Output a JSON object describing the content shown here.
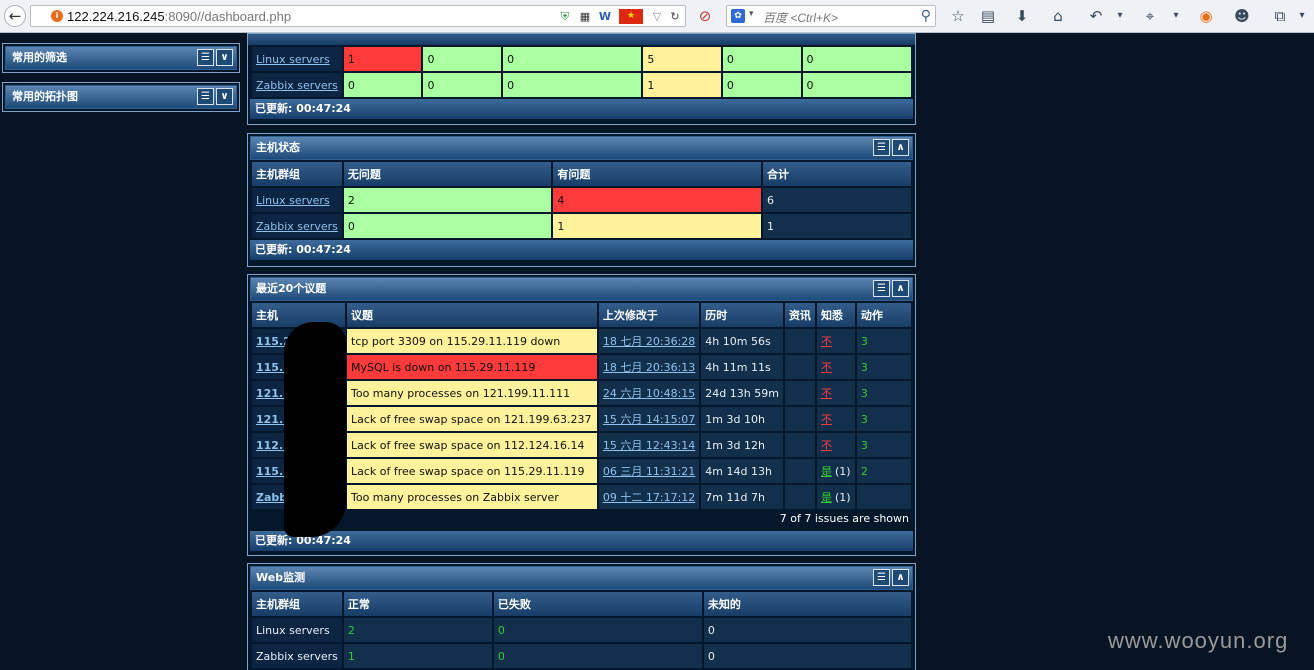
{
  "browser": {
    "url_host": "122.224.216.245",
    "url_rest": ":8090//dashboard.php",
    "search_engine_label": "百度",
    "search_placeholder": "<Ctrl+K>",
    "icons": [
      "back-icon",
      "site-icon",
      "shield-icon",
      "qr-icon",
      "word-icon",
      "china-flag-icon",
      "dropdown-icon",
      "reload-icon",
      "block-icon",
      "paw-icon",
      "search-icon",
      "star-icon",
      "clipboard-icon",
      "download-icon",
      "home-icon",
      "undo-icon",
      "crop-icon",
      "firefox-icon",
      "user-icon",
      "window-icon"
    ]
  },
  "left_panels": [
    {
      "title": "常用的筛选"
    },
    {
      "title": "常用的拓扑图"
    }
  ],
  "trigger_overview": {
    "rows": [
      {
        "group": "Linux servers",
        "cells": [
          "1",
          "0",
          "0",
          "5",
          "0",
          "0"
        ],
        "colors": [
          "r",
          "g",
          "g",
          "y",
          "g",
          "g"
        ]
      },
      {
        "group": "Zabbix servers",
        "cells": [
          "0",
          "0",
          "0",
          "1",
          "0",
          "0"
        ],
        "colors": [
          "g",
          "g",
          "g",
          "y",
          "g",
          "g"
        ]
      }
    ],
    "footer": "已更新: 00:47:24"
  },
  "host_status": {
    "title": "主机状态",
    "headers": [
      "主机群组",
      "无问题",
      "有问题",
      "合计"
    ],
    "rows": [
      {
        "group": "Linux servers",
        "ok": "2",
        "problem": "4",
        "total": "6",
        "problem_color": "r"
      },
      {
        "group": "Zabbix servers",
        "ok": "0",
        "problem": "1",
        "total": "1",
        "problem_color": "y"
      }
    ],
    "footer": "已更新: 00:47:24"
  },
  "last_issues": {
    "title": "最近20个议题",
    "headers": [
      "主机",
      "议题",
      "上次修改于",
      "历时",
      "资讯",
      "知悉",
      "动作"
    ],
    "rows": [
      {
        "host": "115.2",
        "issue": "tcp port 3309 on 115.29.11.119 down",
        "issue_color": "y",
        "changed": "18 七月 20:36:28",
        "age": "4h 10m 56s",
        "ack": "不",
        "ack_type": "no",
        "actions": "3"
      },
      {
        "host": "115.2",
        "issue": "MySQL is down on 115.29.11.119",
        "issue_color": "r",
        "changed": "18 七月 20:36:13",
        "age": "4h 11m 11s",
        "ack": "不",
        "ack_type": "no",
        "actions": "3"
      },
      {
        "host": "121.1",
        "issue": "Too many processes on 121.199.11.111",
        "issue_color": "y",
        "changed": "24 六月 10:48:15",
        "age": "24d 13h 59m",
        "ack": "不",
        "ack_type": "no",
        "actions": "3"
      },
      {
        "host": "121.1",
        "issue": "Lack of free swap space on 121.199.63.237",
        "issue_color": "y",
        "changed": "15 六月 14:15:07",
        "age": "1m 3d 10h",
        "ack": "不",
        "ack_type": "no",
        "actions": "3"
      },
      {
        "host": "112.1",
        "issue": "Lack of free swap space on 112.124.16.14",
        "issue_color": "y",
        "changed": "15 六月 12:43:14",
        "age": "1m 3d 12h",
        "ack": "不",
        "ack_type": "no",
        "actions": "3"
      },
      {
        "host": "115.2",
        "issue": "Lack of free swap space on 115.29.11.119",
        "issue_color": "y",
        "changed": "06 三月 11:31:21",
        "age": "4m 14d 13h",
        "ack": "是",
        "ack_count": "(1)",
        "ack_type": "yes",
        "actions": "2"
      },
      {
        "host": "Zabb",
        "issue": "Too many processes on Zabbix server",
        "issue_color": "y",
        "changed": "09 十二 17:17:12",
        "age": "7m 11d 7h",
        "ack": "是",
        "ack_count": "(1)",
        "ack_type": "yes",
        "actions": ""
      }
    ],
    "shown_text": "7 of 7 issues are shown",
    "footer": "已更新: 00:47:24"
  },
  "web_monitoring": {
    "title": "Web监测",
    "headers": [
      "主机群组",
      "正常",
      "已失败",
      "未知的"
    ],
    "rows": [
      {
        "group": "Linux servers",
        "ok": "2",
        "failed": "0",
        "unknown": "0"
      },
      {
        "group": "Zabbix servers",
        "ok": "1",
        "failed": "0",
        "unknown": "0"
      }
    ]
  },
  "watermark": "www.wooyun.org",
  "colors": {
    "ok": "#aaffa0",
    "problem": "#ff3a3a",
    "warning": "#fff29a",
    "header": "#1d4a78"
  }
}
